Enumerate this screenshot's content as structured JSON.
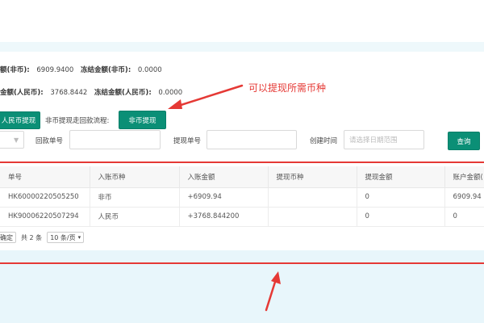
{
  "balances": {
    "foreign_available_label": "额(非币):",
    "foreign_available_value": "6909.9400",
    "foreign_frozen_label": "冻结金额(非币):",
    "foreign_frozen_value": "0.0000",
    "rmb_available_label": "金额(人民币):",
    "rmb_available_value": "3768.8442",
    "rmb_frozen_label": "冻结金额(人民币):",
    "rmb_frozen_value": "0.0000"
  },
  "actions": {
    "rmb_withdraw_label": "人民币提现",
    "foreign_flow_label": "非币提现走回款流程:",
    "foreign_withdraw_label": "非币提现"
  },
  "annotation": {
    "text": "可以提现所需币种",
    "color": "#e53935"
  },
  "filters": {
    "return_no_label": "回款单号",
    "withdraw_no_label": "提现单号",
    "created_time_label": "创建时间",
    "date_placeholder": "请选择日期范围",
    "query_label": "查询"
  },
  "table": {
    "columns": [
      "单号",
      "入账币种",
      "入账金额",
      "提现币种",
      "提现金额",
      "账户金额("
    ],
    "rows": [
      [
        "HK60000220505250",
        "非币",
        "+6909.94",
        "",
        "0",
        "6909.94"
      ],
      [
        "HK90006220507294",
        "人民币",
        "+3768.844200",
        "",
        "0",
        "0"
      ]
    ]
  },
  "pager": {
    "confirm_label": "确定",
    "total_label": "共 2 条",
    "page_size_label": "10 条/页"
  },
  "colors": {
    "accent": "#0b8f76",
    "highlight": "#e53935"
  }
}
